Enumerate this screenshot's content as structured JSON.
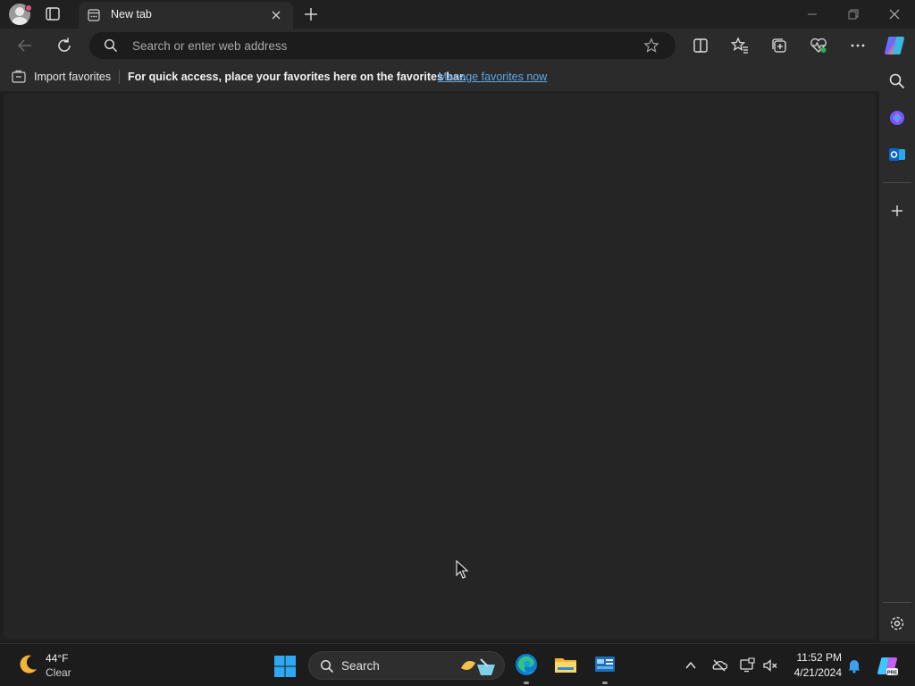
{
  "tabs": [
    {
      "title": "New tab",
      "icon": "new-tab-page-icon",
      "active": true
    }
  ],
  "window_controls": {
    "minimize_icon": "minimize-icon",
    "maximize_icon": "restore-icon",
    "close_icon": "close-icon"
  },
  "toolbar": {
    "back_icon": "back-arrow-icon",
    "refresh_icon": "refresh-icon",
    "address_placeholder": "Search or enter web address",
    "address_value": "",
    "right_icons": [
      "split-screen-icon",
      "favorites-icon",
      "collections-icon",
      "browser-essentials-icon",
      "more-options-icon",
      "copilot-icon"
    ]
  },
  "favorites_bar": {
    "import_label": "Import favorites",
    "message": "For quick access, place your favorites here on the favorites bar.",
    "link_label": "Manage favorites now"
  },
  "sidebar": {
    "items": [
      "search-icon",
      "copilot-icon",
      "outlook-icon",
      "add-icon",
      "settings-icon"
    ]
  },
  "taskbar": {
    "weather": {
      "temperature": "44°F",
      "condition": "Clear",
      "icon": "moon-icon"
    },
    "search_label": "Search",
    "apps": [
      "edge-icon",
      "file-explorer-icon",
      "control-panel-icon"
    ],
    "tray_icons": [
      "chevron-up-icon",
      "onedrive-icon",
      "display-icon",
      "volume-muted-icon"
    ],
    "time": "11:52 PM",
    "date": "4/21/2024"
  },
  "colors": {
    "accent_link": "#5ea7ea",
    "background": "#1f1f1f",
    "content": "#252525"
  }
}
